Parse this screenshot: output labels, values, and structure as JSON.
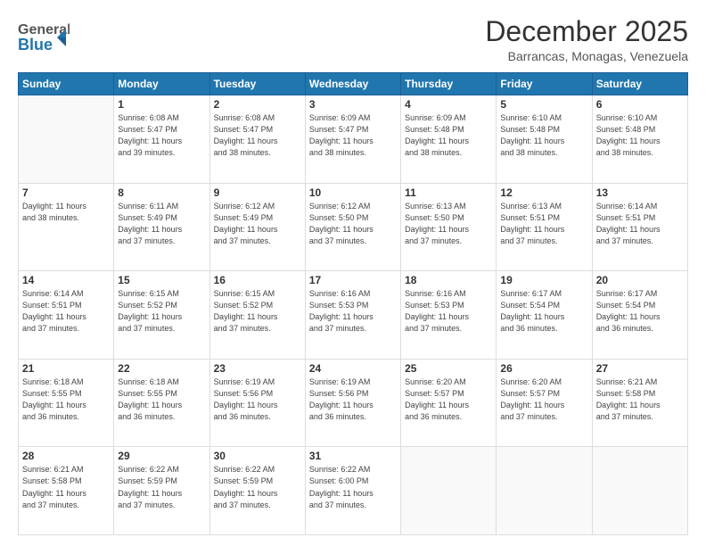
{
  "header": {
    "logo_general": "General",
    "logo_blue": "Blue",
    "month_title": "December 2025",
    "location": "Barrancas, Monagas, Venezuela"
  },
  "weekdays": [
    "Sunday",
    "Monday",
    "Tuesday",
    "Wednesday",
    "Thursday",
    "Friday",
    "Saturday"
  ],
  "weeks": [
    [
      {
        "day": "",
        "info": ""
      },
      {
        "day": "1",
        "info": "Sunrise: 6:08 AM\nSunset: 5:47 PM\nDaylight: 11 hours\nand 39 minutes."
      },
      {
        "day": "2",
        "info": "Sunrise: 6:08 AM\nSunset: 5:47 PM\nDaylight: 11 hours\nand 38 minutes."
      },
      {
        "day": "3",
        "info": "Sunrise: 6:09 AM\nSunset: 5:47 PM\nDaylight: 11 hours\nand 38 minutes."
      },
      {
        "day": "4",
        "info": "Sunrise: 6:09 AM\nSunset: 5:48 PM\nDaylight: 11 hours\nand 38 minutes."
      },
      {
        "day": "5",
        "info": "Sunrise: 6:10 AM\nSunset: 5:48 PM\nDaylight: 11 hours\nand 38 minutes."
      },
      {
        "day": "6",
        "info": "Sunrise: 6:10 AM\nSunset: 5:48 PM\nDaylight: 11 hours\nand 38 minutes."
      }
    ],
    [
      {
        "day": "7",
        "info": "Daylight: 11 hours\nand 38 minutes."
      },
      {
        "day": "8",
        "info": "Sunrise: 6:11 AM\nSunset: 5:49 PM\nDaylight: 11 hours\nand 37 minutes."
      },
      {
        "day": "9",
        "info": "Sunrise: 6:12 AM\nSunset: 5:49 PM\nDaylight: 11 hours\nand 37 minutes."
      },
      {
        "day": "10",
        "info": "Sunrise: 6:12 AM\nSunset: 5:50 PM\nDaylight: 11 hours\nand 37 minutes."
      },
      {
        "day": "11",
        "info": "Sunrise: 6:13 AM\nSunset: 5:50 PM\nDaylight: 11 hours\nand 37 minutes."
      },
      {
        "day": "12",
        "info": "Sunrise: 6:13 AM\nSunset: 5:51 PM\nDaylight: 11 hours\nand 37 minutes."
      },
      {
        "day": "13",
        "info": "Sunrise: 6:14 AM\nSunset: 5:51 PM\nDaylight: 11 hours\nand 37 minutes."
      }
    ],
    [
      {
        "day": "14",
        "info": "Sunrise: 6:14 AM\nSunset: 5:51 PM\nDaylight: 11 hours\nand 37 minutes."
      },
      {
        "day": "15",
        "info": "Sunrise: 6:15 AM\nSunset: 5:52 PM\nDaylight: 11 hours\nand 37 minutes."
      },
      {
        "day": "16",
        "info": "Sunrise: 6:15 AM\nSunset: 5:52 PM\nDaylight: 11 hours\nand 37 minutes."
      },
      {
        "day": "17",
        "info": "Sunrise: 6:16 AM\nSunset: 5:53 PM\nDaylight: 11 hours\nand 37 minutes."
      },
      {
        "day": "18",
        "info": "Sunrise: 6:16 AM\nSunset: 5:53 PM\nDaylight: 11 hours\nand 37 minutes."
      },
      {
        "day": "19",
        "info": "Sunrise: 6:17 AM\nSunset: 5:54 PM\nDaylight: 11 hours\nand 36 minutes."
      },
      {
        "day": "20",
        "info": "Sunrise: 6:17 AM\nSunset: 5:54 PM\nDaylight: 11 hours\nand 36 minutes."
      }
    ],
    [
      {
        "day": "21",
        "info": "Sunrise: 6:18 AM\nSunset: 5:55 PM\nDaylight: 11 hours\nand 36 minutes."
      },
      {
        "day": "22",
        "info": "Sunrise: 6:18 AM\nSunset: 5:55 PM\nDaylight: 11 hours\nand 36 minutes."
      },
      {
        "day": "23",
        "info": "Sunrise: 6:19 AM\nSunset: 5:56 PM\nDaylight: 11 hours\nand 36 minutes."
      },
      {
        "day": "24",
        "info": "Sunrise: 6:19 AM\nSunset: 5:56 PM\nDaylight: 11 hours\nand 36 minutes."
      },
      {
        "day": "25",
        "info": "Sunrise: 6:20 AM\nSunset: 5:57 PM\nDaylight: 11 hours\nand 36 minutes."
      },
      {
        "day": "26",
        "info": "Sunrise: 6:20 AM\nSunset: 5:57 PM\nDaylight: 11 hours\nand 37 minutes."
      },
      {
        "day": "27",
        "info": "Sunrise: 6:21 AM\nSunset: 5:58 PM\nDaylight: 11 hours\nand 37 minutes."
      }
    ],
    [
      {
        "day": "28",
        "info": "Sunrise: 6:21 AM\nSunset: 5:58 PM\nDaylight: 11 hours\nand 37 minutes."
      },
      {
        "day": "29",
        "info": "Sunrise: 6:22 AM\nSunset: 5:59 PM\nDaylight: 11 hours\nand 37 minutes."
      },
      {
        "day": "30",
        "info": "Sunrise: 6:22 AM\nSunset: 5:59 PM\nDaylight: 11 hours\nand 37 minutes."
      },
      {
        "day": "31",
        "info": "Sunrise: 6:22 AM\nSunset: 6:00 PM\nDaylight: 11 hours\nand 37 minutes."
      },
      {
        "day": "",
        "info": ""
      },
      {
        "day": "",
        "info": ""
      },
      {
        "day": "",
        "info": ""
      }
    ]
  ]
}
